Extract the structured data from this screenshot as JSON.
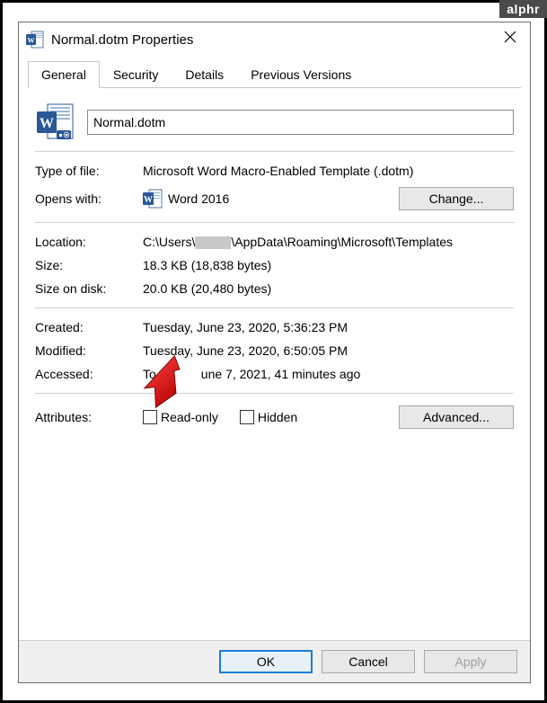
{
  "branding": {
    "logo": "alphr"
  },
  "window": {
    "title": "Normal.dotm Properties"
  },
  "tabs": [
    {
      "label": "General",
      "active": true
    },
    {
      "label": "Security",
      "active": false
    },
    {
      "label": "Details",
      "active": false
    },
    {
      "label": "Previous Versions",
      "active": false
    }
  ],
  "file": {
    "name": "Normal.dotm",
    "type_label": "Type of file:",
    "type_value": "Microsoft Word Macro-Enabled Template (.dotm)",
    "opens_label": "Opens with:",
    "opens_app": "Word 2016",
    "change_button": "Change...",
    "location_label": "Location:",
    "location_prefix": "C:\\Users\\",
    "location_suffix": "\\AppData\\Roaming\\Microsoft\\Templates",
    "size_label": "Size:",
    "size_value": "18.3 KB (18,838 bytes)",
    "disk_label": "Size on disk:",
    "disk_value": "20.0 KB (20,480 bytes)",
    "created_label": "Created:",
    "created_value": "Tuesday, June 23, 2020, 5:36:23 PM",
    "modified_label": "Modified:",
    "modified_value": "Tuesday, June 23, 2020, 6:50:05 PM",
    "accessed_label": "Accessed:",
    "accessed_prefix": "To",
    "accessed_suffix": "une 7, 2021, 41 minutes ago",
    "attributes_label": "Attributes:",
    "readonly_label": "Read-only",
    "hidden_label": "Hidden",
    "advanced_button": "Advanced..."
  },
  "buttons": {
    "ok": "OK",
    "cancel": "Cancel",
    "apply": "Apply"
  }
}
